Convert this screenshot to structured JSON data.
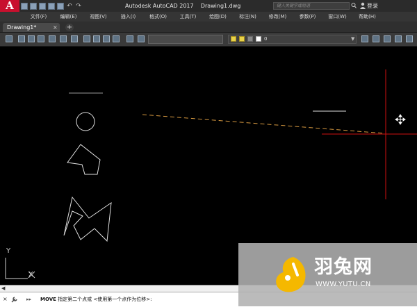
{
  "titlebar": {
    "app_logo": "A",
    "title": "Autodesk AutoCAD 2017    Drawing1.dwg",
    "search_placeholder": "键入关键字或短语",
    "signin": "登录"
  },
  "menubar": {
    "items": [
      "文件(F)",
      "编辑(E)",
      "视图(V)",
      "插入(I)",
      "格式(O)",
      "工具(T)",
      "绘图(D)",
      "标注(N)",
      "修改(M)",
      "参数(P)",
      "窗口(W)",
      "帮助(H)"
    ]
  },
  "tabs": {
    "file_tab": "Drawing1*",
    "close": "×",
    "new_tab": "+"
  },
  "toolbar": {
    "layer_name": "0"
  },
  "ucs": {
    "y_label": "Y",
    "x_label": "X"
  },
  "commandline": {
    "close": "×",
    "prompt_chevrons": "▸▸",
    "keyword": "MOVE",
    "text": " 指定第二个点或 <使用第一个点作为位移>:"
  },
  "watermark": {
    "title": "羽兔网",
    "url": "WWW.YUTU.CN"
  },
  "colors": {
    "crosshair": "#d01010",
    "rubberband": "#d89a40",
    "geometry": "#e0e0e0",
    "autocad_red": "#c8102e"
  },
  "icons": [
    "app-logo-icon",
    "search-icon",
    "user-icon",
    "move-cursor-icon",
    "wrench-icon",
    "ucs-icon",
    "watermark-logo-icon"
  ]
}
